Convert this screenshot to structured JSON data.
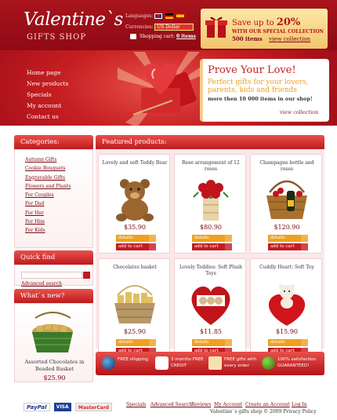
{
  "header": {
    "logo_title": "Valentine`s",
    "logo_sub": "GIFTS SHOP",
    "languages_label": "Languages:",
    "currencies_label": "Currencies:",
    "currency_value": "US Dollar",
    "cart_label": "Shopping cart:",
    "cart_value": "0 items"
  },
  "promo": {
    "line1_prefix": "Save up to",
    "line1_value": "20%",
    "line2": "WITH OUR SPECIAL COLLECTION",
    "line3": "500 items",
    "link": "view collection"
  },
  "nav": [
    "Home page",
    "New products",
    "Specials",
    "My account",
    "Contact us"
  ],
  "hero": {
    "title": "Prove Your Love!",
    "line1": "Perfect gifts for your lovers, parents, kids and friends",
    "line2": "more then 10 000 items in our shop!",
    "link": "view collection"
  },
  "categories": {
    "title": "Categories:",
    "items": [
      "Autumn Gifts",
      "Cookie Bouquets",
      "Engravable Gifts",
      "Flowers and Plants",
      "For Couples",
      "For Dad",
      "For Her",
      "For Him",
      "For Kids"
    ]
  },
  "search": {
    "title": "Quick find",
    "advanced": "Advanced search"
  },
  "whats_new": {
    "title": "What`s new?",
    "name": "Assorted Chocolates in Beaded Basket",
    "price": "$25.90"
  },
  "featured": {
    "title": "Featured products:",
    "details_label": "details",
    "cart_label": "add to cart",
    "products": [
      {
        "name": "Lovely and soft Teddy Bear",
        "price": "$35.90"
      },
      {
        "name": "Rose arrangement of 12 roses",
        "price": "$80.90"
      },
      {
        "name": "Champagne bottle and roses",
        "price": "$120.90"
      },
      {
        "name": "Chocolates basket",
        "price": "$25.90"
      },
      {
        "name": "Lovely Teddies: Soft Plush Toys",
        "price": "$11.85"
      },
      {
        "name": "Cuddly Heart: Soft Toy",
        "price": "$15.90"
      }
    ]
  },
  "strip": [
    {
      "text": "FREE shipping"
    },
    {
      "text": "3 months FREE CREDIT"
    },
    {
      "text": "FREE gifts with every order"
    },
    {
      "text": "100% satisfaction GUARANTEED!"
    }
  ],
  "footer": {
    "payments": [
      "PayPal",
      "VISA",
      "MasterCard"
    ],
    "links": [
      "Specials",
      "Advanced Search",
      "Reviews",
      "My Account",
      "Create an Account",
      "Log In"
    ],
    "copyright": "Valentine`s gifts shop © 2009 Privacy Policy"
  },
  "colors": {
    "primary_red": "#c61f22",
    "gold": "#f0a020",
    "dark_red": "#7a0a12"
  }
}
